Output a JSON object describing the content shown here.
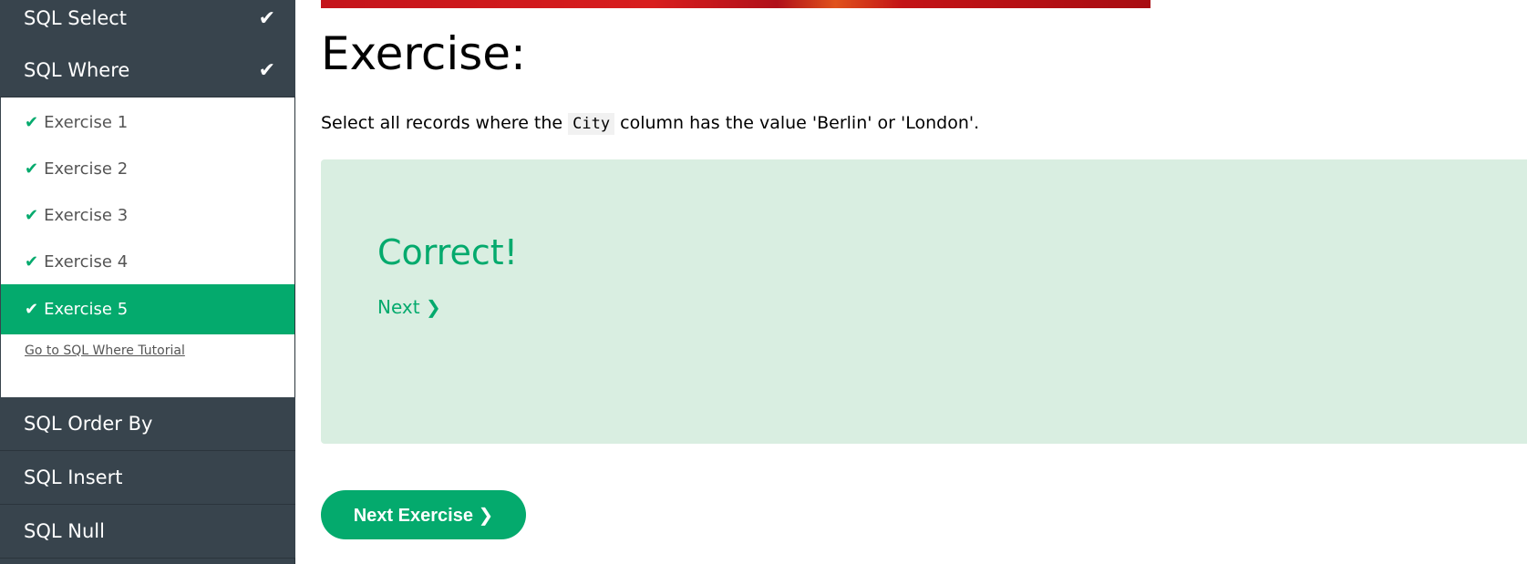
{
  "sidebar": {
    "sections_top": [
      {
        "label": "SQL Select",
        "checked": true
      },
      {
        "label": "SQL Where",
        "checked": true
      }
    ],
    "exercises": [
      {
        "label": "Exercise 1",
        "active": false
      },
      {
        "label": "Exercise 2",
        "active": false
      },
      {
        "label": "Exercise 3",
        "active": false
      },
      {
        "label": "Exercise 4",
        "active": false
      },
      {
        "label": "Exercise 5",
        "active": true
      }
    ],
    "tutorial_link": "Go to SQL Where Tutorial",
    "sections_bottom": [
      {
        "label": "SQL Order By"
      },
      {
        "label": "SQL Insert"
      },
      {
        "label": "SQL Null"
      }
    ],
    "check_icon": "✔",
    "tick_icon": "✔"
  },
  "main": {
    "title": "Exercise:",
    "instruction_before": "Select all records where the ",
    "instruction_code": "City",
    "instruction_after": " column has the value 'Berlin' or 'London'.",
    "result": {
      "status": "Correct!",
      "next_link": "Next ❯"
    },
    "next_exercise_button": "Next Exercise ❯"
  },
  "colors": {
    "sidebar_bg": "#38444d",
    "accent": "#04aa6d",
    "result_bg": "#d9eee1"
  }
}
